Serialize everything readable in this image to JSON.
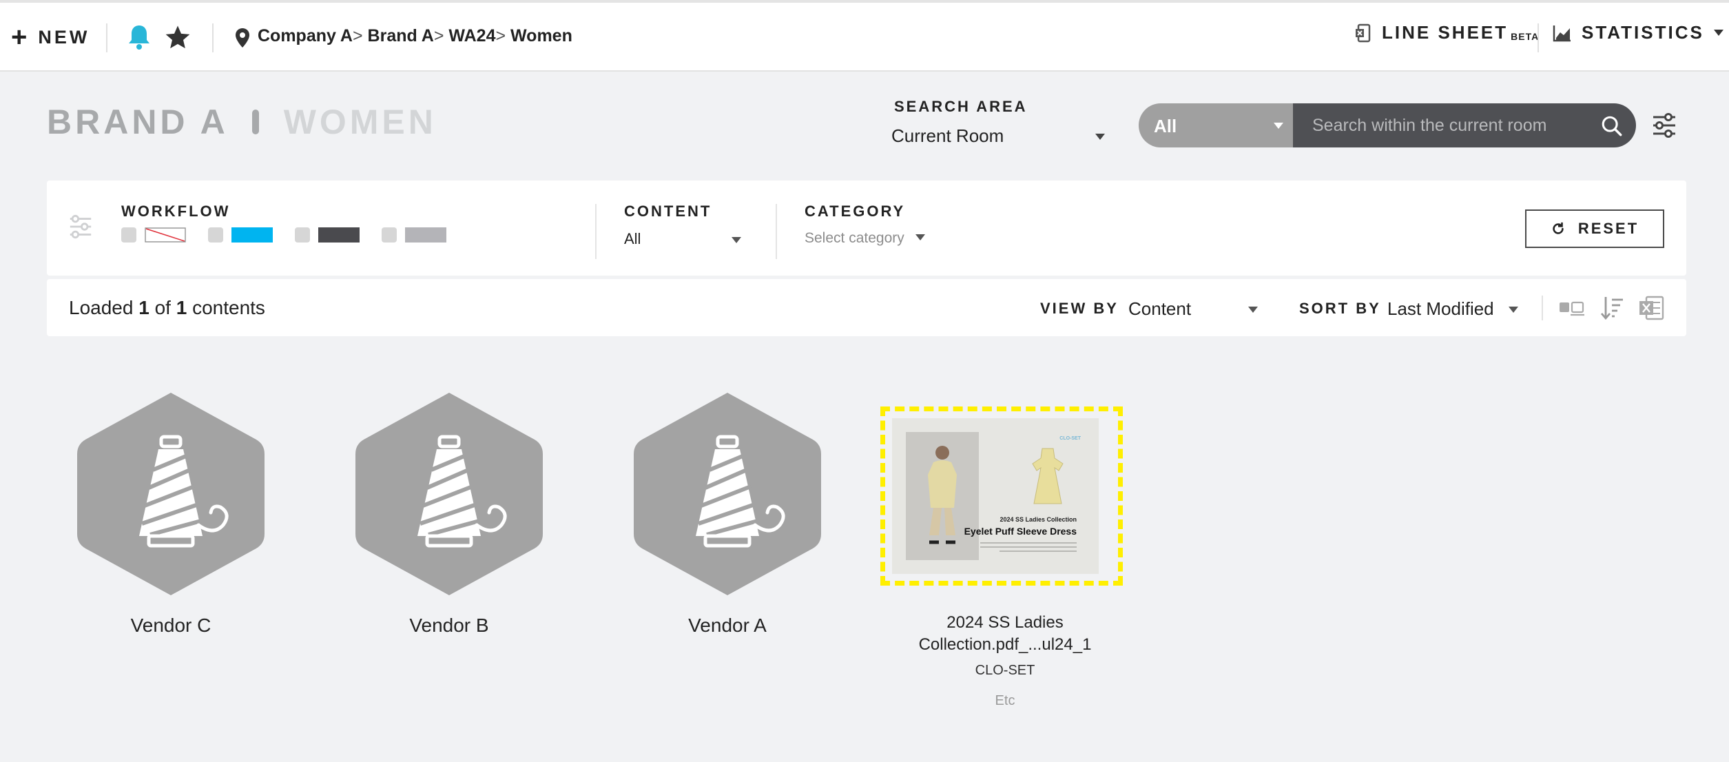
{
  "topbar": {
    "new_label": "NEW",
    "breadcrumb": [
      "Company A",
      "Brand A",
      "WA24",
      "Women"
    ],
    "line_sheet_label": "LINE SHEET",
    "beta_label": "BETA",
    "statistics_label": "STATISTICS"
  },
  "header": {
    "brand": "BRAND A",
    "section": "WOMEN",
    "search_area_label": "SEARCH AREA",
    "search_area_value": "Current Room",
    "search_scope": "All",
    "search_placeholder": "Search within the current room"
  },
  "filters": {
    "workflow_label": "WORKFLOW",
    "workflow_colors": [
      "none",
      "#00b4f0",
      "#4a4a4e",
      "#b4b4b8"
    ],
    "content_label": "CONTENT",
    "content_value": "All",
    "category_label": "CATEGORY",
    "category_placeholder": "Select category",
    "reset_label": "RESET"
  },
  "toolbar": {
    "loaded_prefix": "Loaded",
    "loaded_count": "1",
    "loaded_of": "of",
    "loaded_total": "1",
    "loaded_suffix": "contents",
    "view_by_label": "VIEW BY",
    "view_by_value": "Content",
    "sort_by_label": "SORT BY",
    "sort_by_value": "Last Modified"
  },
  "items": [
    {
      "name": "Vendor C",
      "type": "vendor-room"
    },
    {
      "name": "Vendor B",
      "type": "vendor-room"
    },
    {
      "name": "Vendor A",
      "type": "vendor-room"
    },
    {
      "name": "2024 SS Ladies Collection.pdf_...ul24_1",
      "owner": "CLO-SET",
      "category": "Etc",
      "thumb_brand": "CLO-SET",
      "thumb_subtitle": "2024 SS Ladies Collection",
      "thumb_title": "Eyelet Puff Sleeve Dress",
      "highlight_color": "#ffef00"
    }
  ],
  "colors": {
    "accent_bell": "#29b6d8",
    "hex_fill": "#a3a3a3",
    "search_bg": "#4f5054"
  }
}
